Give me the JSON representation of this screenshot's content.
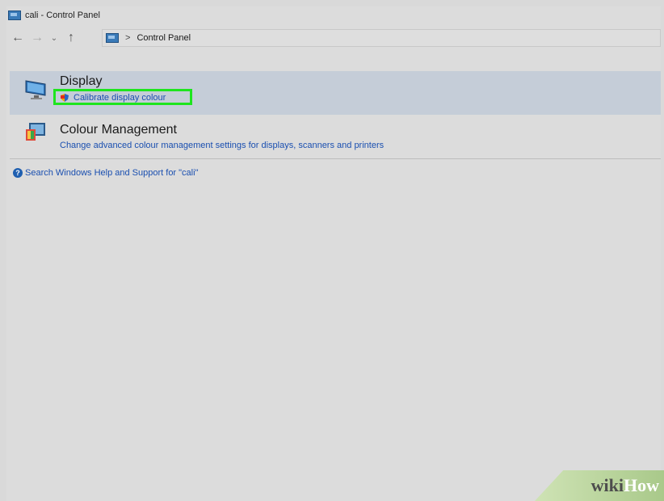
{
  "window": {
    "title": "cali - Control Panel"
  },
  "address": {
    "path": "Control Panel",
    "separator": ">"
  },
  "nav": {
    "back": "←",
    "forward": "→",
    "recent": "⌄",
    "up": "↑"
  },
  "results": [
    {
      "title": "Display",
      "link": "Calibrate display colour",
      "icon": "monitor-icon"
    },
    {
      "title": "Colour Management",
      "link": "Change advanced colour management settings for displays, scanners and printers",
      "icon": "colour-management-icon"
    }
  ],
  "help": {
    "text": "Search Windows Help and Support for \"cali\"",
    "icon": "?"
  },
  "watermark": {
    "wiki": "wiki",
    "how": "How"
  },
  "colors": {
    "highlight": "#1ee51e",
    "link": "#1a4fb0",
    "selected_bg": "#c5cdd8"
  }
}
